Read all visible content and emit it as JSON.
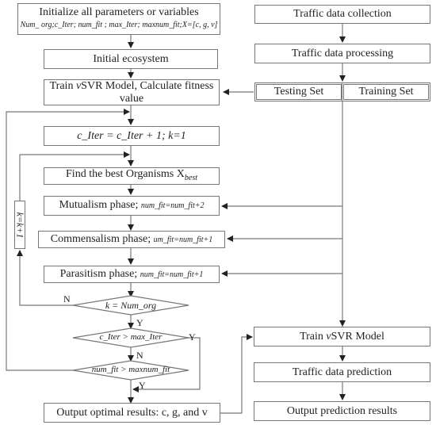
{
  "left": {
    "init_title": "Initialize all parameters or variables",
    "init_sub": "Num_ org;c_Iter; num_fit ; max_Iter; maxnum_fit;X=[c, g, v]",
    "initial_ecosystem": "Initial ecosystem",
    "train_1": "Train ",
    "train_nu": "v",
    "train_2": "SVR Model, Calculate fitness value",
    "iter_update": "c_Iter = c_Iter + 1; k=1",
    "find_best": "Find the best Organisms X",
    "find_best_sub": "best",
    "mutualism": "Mutualism phase; ",
    "mutualism_sub": "num_fit=num_fit+2",
    "commensalism": "Commensalism phase; ",
    "commensalism_sub": "um_fit=num_fit+1",
    "parasitism": "Parasitism phase; ",
    "parasitism_sub": "num_fit=num_fit+1",
    "k_increment": "k=k+1",
    "cond_k": "k = Num_org",
    "cond_iter": "c_Iter > max_Iter",
    "cond_fit": "num_fit > maxnum_fit",
    "output": "Output optimal results: c, g, and v"
  },
  "right": {
    "collection": "Traffic data collection",
    "processing": "Traffic data processing",
    "testing": "Testing Set",
    "training": "Training Set",
    "train_1": "Train ",
    "train_nu": "v",
    "train_2": "SVR Model",
    "prediction": "Traffic data prediction",
    "output": "Output prediction results"
  },
  "labels": {
    "n1": "N",
    "y1": "Y",
    "y2": "Y",
    "n2": "N",
    "y3": "Y"
  }
}
